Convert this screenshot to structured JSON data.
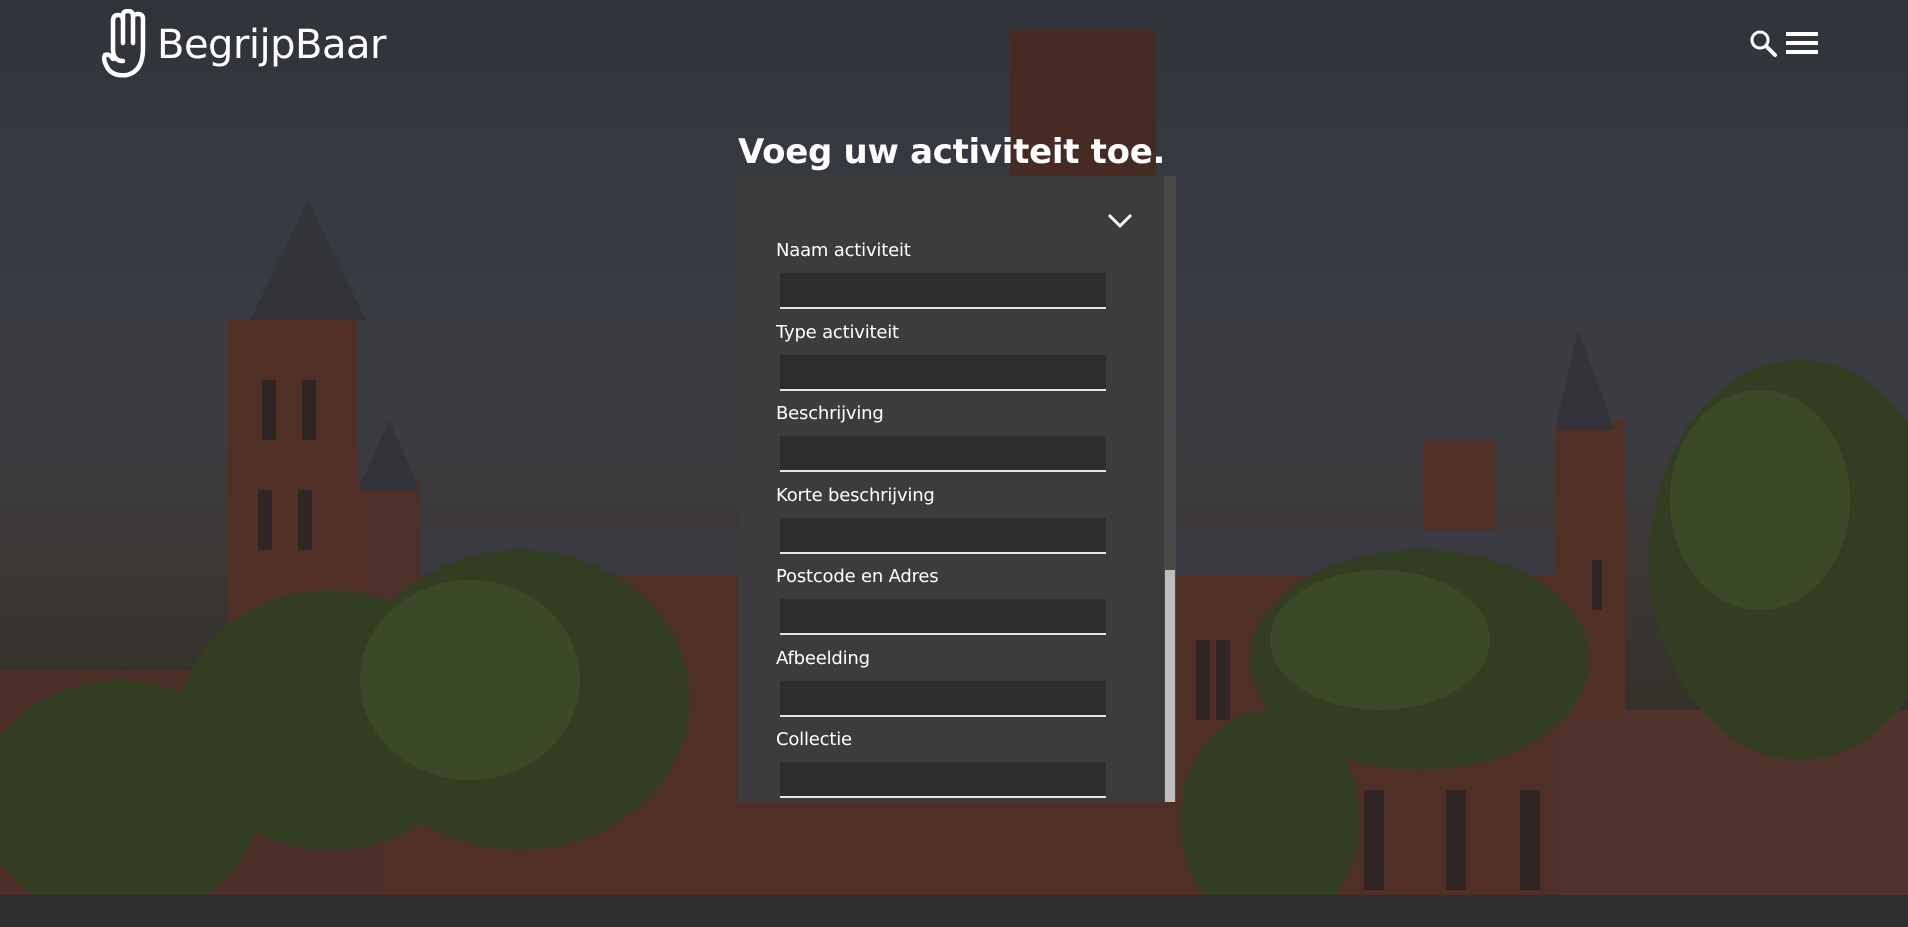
{
  "header": {
    "logo_text": "BegrijpBaar",
    "search_icon": "search-icon",
    "menu_icon": "hamburger-menu-icon"
  },
  "form": {
    "title": "Voeg uw activiteit toe.",
    "toggle_icon": "chevron-down-icon",
    "fields": [
      {
        "label": "Naam activiteit",
        "value": ""
      },
      {
        "label": "Type activiteit",
        "value": ""
      },
      {
        "label": "Beschrijving",
        "value": ""
      },
      {
        "label": "Korte beschrijving",
        "value": ""
      },
      {
        "label": "Postcode en Adres",
        "value": ""
      },
      {
        "label": "Afbeelding",
        "value": ""
      },
      {
        "label": "Collectie",
        "value": ""
      }
    ]
  },
  "colors": {
    "panel_bg": "#3c3c3c",
    "input_bg": "#2d2d2d",
    "input_underline": "#e6e6e6",
    "text": "#ffffff"
  }
}
